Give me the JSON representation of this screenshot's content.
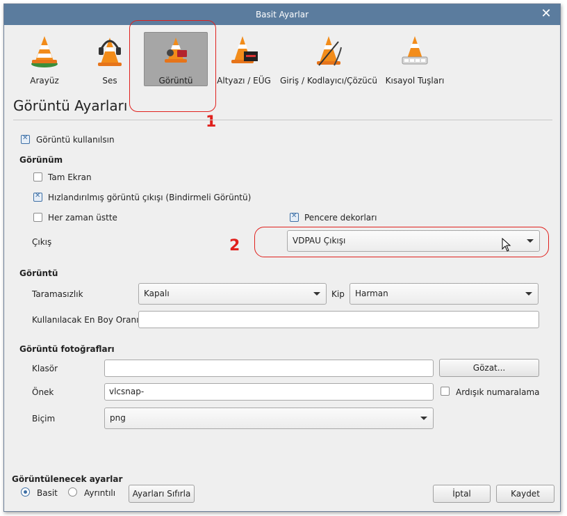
{
  "window": {
    "title": "Basit Ayarlar",
    "close_icon": "close-icon"
  },
  "categories": [
    {
      "label": "Arayüz",
      "icon": "vlc-cone-interface-icon"
    },
    {
      "label": "Ses",
      "icon": "vlc-cone-headphones-icon"
    },
    {
      "label": "Görüntü",
      "icon": "vlc-cone-video-icon",
      "selected": true
    },
    {
      "label": "Altyazı / EÜG",
      "icon": "vlc-cone-subtitles-icon"
    },
    {
      "label": "Giriş / Kodlayıcı/Çözücü",
      "icon": "vlc-cone-codecs-icon"
    },
    {
      "label": "Kısayol Tuşları",
      "icon": "vlc-cone-hotkeys-icon"
    }
  ],
  "annotations": {
    "one": "1",
    "two": "2"
  },
  "page_title": "Görüntü Ayarları",
  "enable_video": {
    "label": "Görüntü kullanılsın",
    "checked": true
  },
  "display": {
    "section": "Görünüm",
    "fullscreen": {
      "label": "Tam Ekran",
      "checked": false
    },
    "accelerated": {
      "label": "Hızlandırılmış görüntü çıkışı (Bindirmeli Görüntü)",
      "checked": true
    },
    "always_on_top": {
      "label": "Her zaman üstte",
      "checked": false
    },
    "window_decorations": {
      "label": "Pencere dekorları",
      "checked": true
    },
    "output_label": "Çıkış",
    "output_value": "VDPAU Çıkışı"
  },
  "video": {
    "section": "Görüntü",
    "deinterlace_label": "Taramasızlık",
    "deinterlace_value": "Kapalı",
    "mode_label": "Kip",
    "mode_value": "Harman",
    "aspect_label": "Kullanılacak En Boy Oranı",
    "aspect_value": ""
  },
  "snapshots": {
    "section": "Görüntü fotoğrafları",
    "folder_label": "Klasör",
    "folder_value": "",
    "browse_label": "Gözat...",
    "prefix_label": "Önek",
    "prefix_value": "vlcsnap-",
    "sequential_label": "Ardışık numaralama",
    "sequential_checked": false,
    "format_label": "Biçim",
    "format_value": "png"
  },
  "footer": {
    "show_settings_label": "Görüntülenecek ayarlar",
    "simple_label": "Basit",
    "advanced_label": "Ayrıntılı",
    "simple_selected": true,
    "reset_label": "Ayarları Sıfırla",
    "cancel_label": "İptal",
    "save_label": "Kaydet"
  },
  "colors": {
    "titlebar": "#5b7c9e",
    "annotation": "#e0201c",
    "window_bg": "#efefef"
  }
}
